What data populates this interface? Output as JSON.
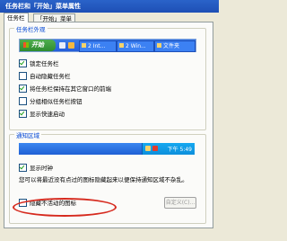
{
  "window": {
    "title": "任务栏和「开始」菜单属性"
  },
  "tabs": [
    "任务栏",
    "「开始」菜单"
  ],
  "taskbar_appearance": {
    "group_label": "任务栏外观",
    "start_label": "开始",
    "buttons": [
      "2 Int...",
      "2 Win...",
      "文件夹"
    ],
    "options": [
      {
        "label": "锁定任务栏",
        "checked": true
      },
      {
        "label": "自动隐藏任务栏",
        "checked": false
      },
      {
        "label": "将任务栏保持在其它窗口的前端",
        "checked": true
      },
      {
        "label": "分组相似任务栏按钮",
        "checked": false
      },
      {
        "label": "显示快速启动",
        "checked": true
      }
    ]
  },
  "notification_area": {
    "group_label": "通知区域",
    "clock_text": "下午 5:49",
    "show_clock": {
      "label": "显示时钟",
      "checked": true
    },
    "description": "您可以将最近没有点过的图标隐藏起来以便保持通知区域不杂乱。",
    "hide_inactive": {
      "label": "隐藏不活动的图标",
      "checked": false
    },
    "customize_label": "自定义(C)..."
  },
  "colors": {
    "title_blue": "#1e4fb5",
    "group_label": "#0046d5",
    "highlight": "#d62a1e"
  }
}
